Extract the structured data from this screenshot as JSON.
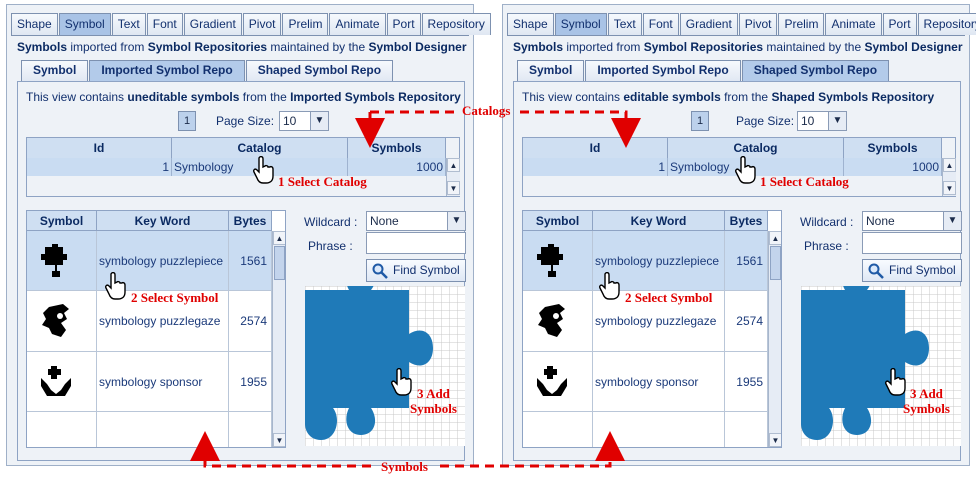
{
  "colors": {
    "accent": "#1f7ab8",
    "annotation": "#e00000",
    "selection": "#c9dcf2"
  },
  "tabs": [
    "Shape",
    "Symbol",
    "Text",
    "Font",
    "Gradient",
    "Pivot",
    "Prelim",
    "Animate",
    "Port",
    "Repository"
  ],
  "active_tab": "Symbol",
  "description": {
    "part1": "Symbols",
    "part2": " imported from ",
    "part3": "Symbol Repositories",
    "part4": " maintained by the ",
    "part5": "Symbol Designer"
  },
  "panels": [
    {
      "subtabs": [
        "Symbol",
        "Imported Symbol Repo",
        "Shaped Symbol Repo"
      ],
      "active_subtab": "Imported Symbol Repo",
      "info": {
        "prefix": "This view contains ",
        "bold1": "uneditable symbols",
        "mid": " from the ",
        "bold2": "Imported Symbols Repository"
      }
    },
    {
      "subtabs": [
        "Symbol",
        "Imported Symbol Repo",
        "Shaped Symbol Repo"
      ],
      "active_subtab": "Shaped Symbol Repo",
      "info": {
        "prefix": "This view contains ",
        "bold1": "editable symbols",
        "mid": " from the ",
        "bold2": "Shaped Symbols Repository"
      }
    }
  ],
  "paging": {
    "page": "1",
    "page_size_label": "Page Size:",
    "page_size": "10"
  },
  "catalog_table": {
    "columns": [
      "Id",
      "Catalog",
      "Symbols"
    ],
    "rows": [
      {
        "id": "1",
        "catalog": "Symbology",
        "symbols": "1000"
      }
    ]
  },
  "symbol_table": {
    "columns": [
      "Symbol",
      "Key Word",
      "Bytes"
    ],
    "rows": [
      {
        "icon": "puzzle-piece-icon",
        "keyword": "symbology puzzlepiece",
        "bytes": "1561"
      },
      {
        "icon": "puzzle-gaze-icon",
        "keyword": "symbology puzzlegaze",
        "bytes": "2574"
      },
      {
        "icon": "sponsor-hands-icon",
        "keyword": "symbology sponsor",
        "bytes": "1955"
      }
    ]
  },
  "filter": {
    "wildcard_label": "Wildcard :",
    "wildcard_value": "None",
    "phrase_label": "Phrase :",
    "phrase_value": "",
    "find_button": "Find Symbol"
  },
  "annotations": {
    "catalogs": "Catalogs",
    "symbols": "Symbols",
    "select_catalog": "1 Select Catalog",
    "select_symbol": "2 Select Symbol",
    "add_symbols_1": "3 Add",
    "add_symbols_2": "Symbols"
  }
}
